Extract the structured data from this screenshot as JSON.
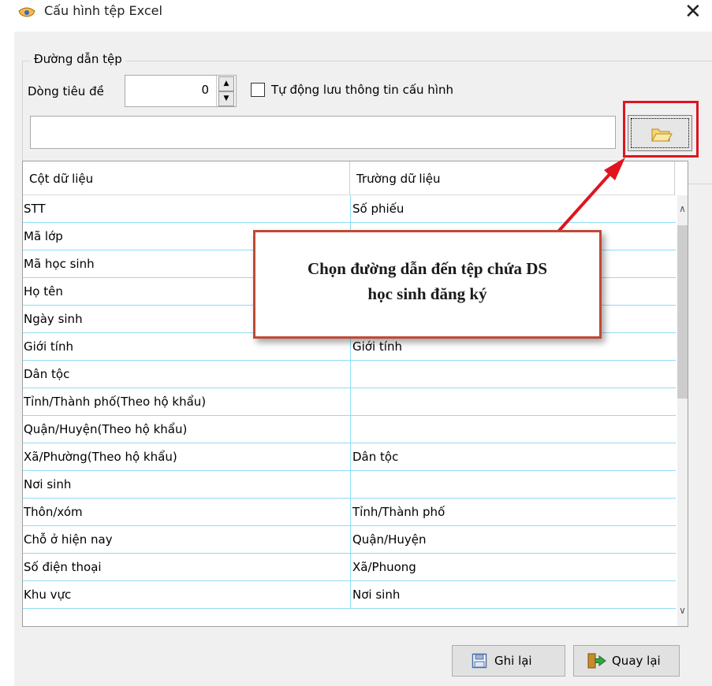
{
  "window": {
    "title": "Cấu hình tệp Excel",
    "close_glyph": "✕"
  },
  "path_group": {
    "legend": "Đường dẫn tệp",
    "header_row_label": "Dòng tiêu đề",
    "header_row_value": "0",
    "auto_save_label": "Tự động lưu thông tin cấu hình",
    "auto_save_checked": false,
    "path_value": ""
  },
  "grid": {
    "columns": [
      "Cột dữ liệu",
      "Trường dữ liệu"
    ],
    "rows": [
      [
        "STT",
        "Số phiếu"
      ],
      [
        "Mã lớp",
        ""
      ],
      [
        "Mã học sinh",
        ""
      ],
      [
        "Họ tên",
        ""
      ],
      [
        "Ngày sinh",
        ""
      ],
      [
        "Giới tính",
        "Giới tính"
      ],
      [
        "Dân tộc",
        ""
      ],
      [
        "Tỉnh/Thành phố(Theo hộ khẩu)",
        ""
      ],
      [
        "Quận/Huyện(Theo hộ khẩu)",
        ""
      ],
      [
        "Xã/Phường(Theo hộ khẩu)",
        "Dân tộc"
      ],
      [
        "Nơi sinh",
        ""
      ],
      [
        "Thôn/xóm",
        "Tỉnh/Thành phố"
      ],
      [
        "Chỗ ở hiện nay",
        "Quận/Huyện"
      ],
      [
        "Số điện thoại",
        "Xã/Phuong"
      ],
      [
        "Khu vực",
        "Nơi sinh"
      ]
    ]
  },
  "callout": {
    "line1": "Chọn đường dẫn đến tệp chứa DS",
    "line2": "học sinh đăng ký"
  },
  "buttons": {
    "save": "Ghi lại",
    "back": "Quay lại"
  },
  "icons": {
    "window": "app-icon",
    "browse": "folder-open-icon",
    "save": "floppy-disk-icon",
    "back": "exit-door-icon"
  },
  "colors": {
    "highlight": "#e0141e",
    "callout_border": "#bf4a36",
    "grid_lines": "#8edcf5"
  }
}
